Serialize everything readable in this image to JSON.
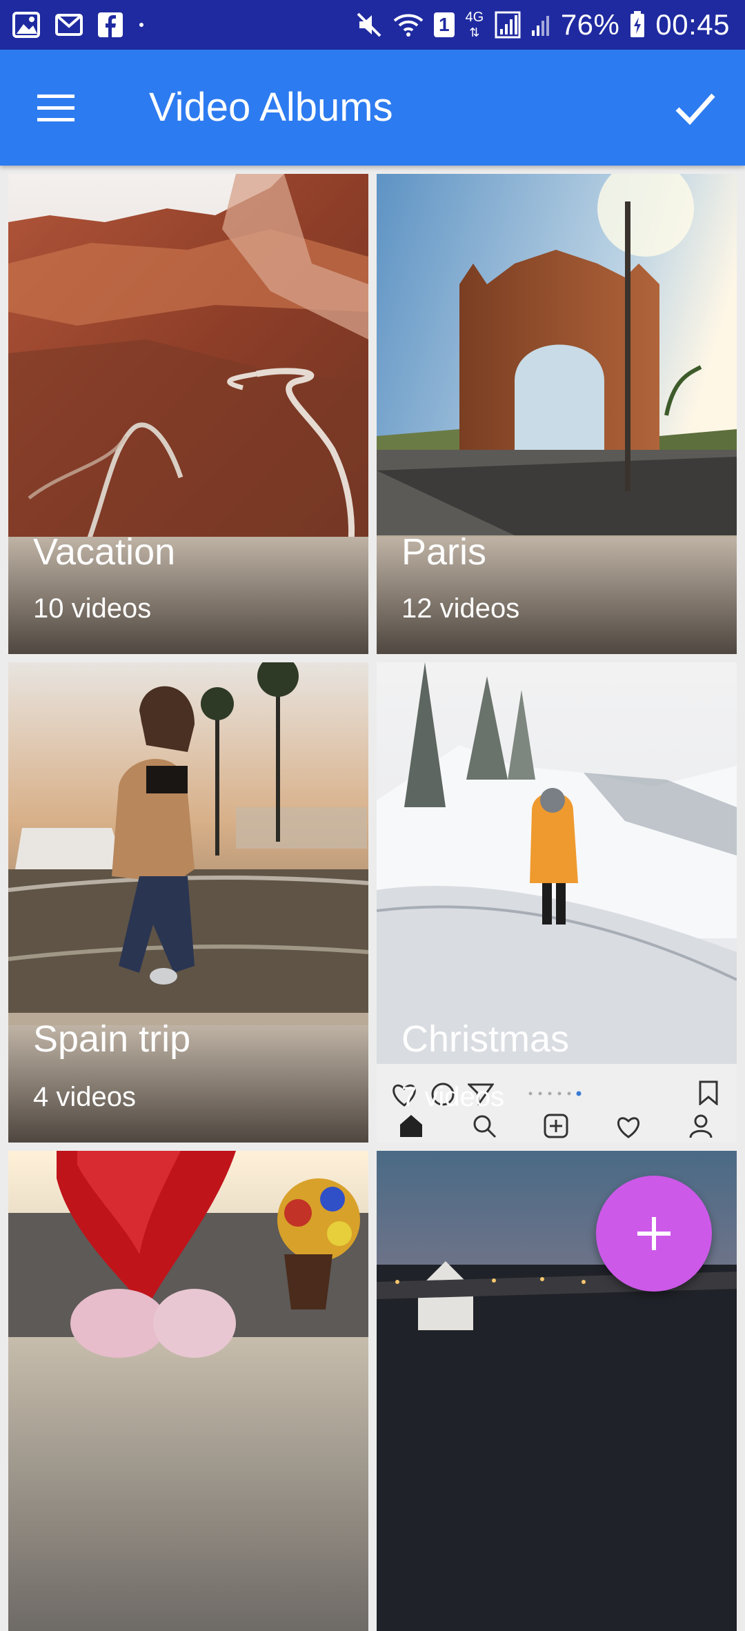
{
  "status_bar": {
    "battery_percent": "76%",
    "time": "00:45",
    "network": "4G",
    "sim_badge": "1",
    "left_icons": [
      "gallery-icon",
      "gmail-icon",
      "facebook-icon",
      "dot-icon"
    ],
    "right_icons": [
      "mute-icon",
      "wifi-icon",
      "signal-icon",
      "battery-icon"
    ]
  },
  "app_bar": {
    "title": "Video Albums",
    "menu_icon": "hamburger-menu-icon",
    "confirm_icon": "check-icon"
  },
  "albums": [
    {
      "title": "Vacation",
      "count": "10 videos"
    },
    {
      "title": "Paris",
      "count": "12 videos"
    },
    {
      "title": "Spain trip",
      "count": "4 videos"
    },
    {
      "title": "Christmas",
      "count": "7 videos"
    },
    {
      "title": "",
      "count": ""
    },
    {
      "title": "",
      "count": ""
    }
  ],
  "fab": {
    "icon": "plus-icon"
  },
  "colors": {
    "status_bar": "#1f2aa0",
    "app_bar": "#2d7bf0",
    "fab": "#cc59e8",
    "text_on_primary": "#ffffff"
  }
}
